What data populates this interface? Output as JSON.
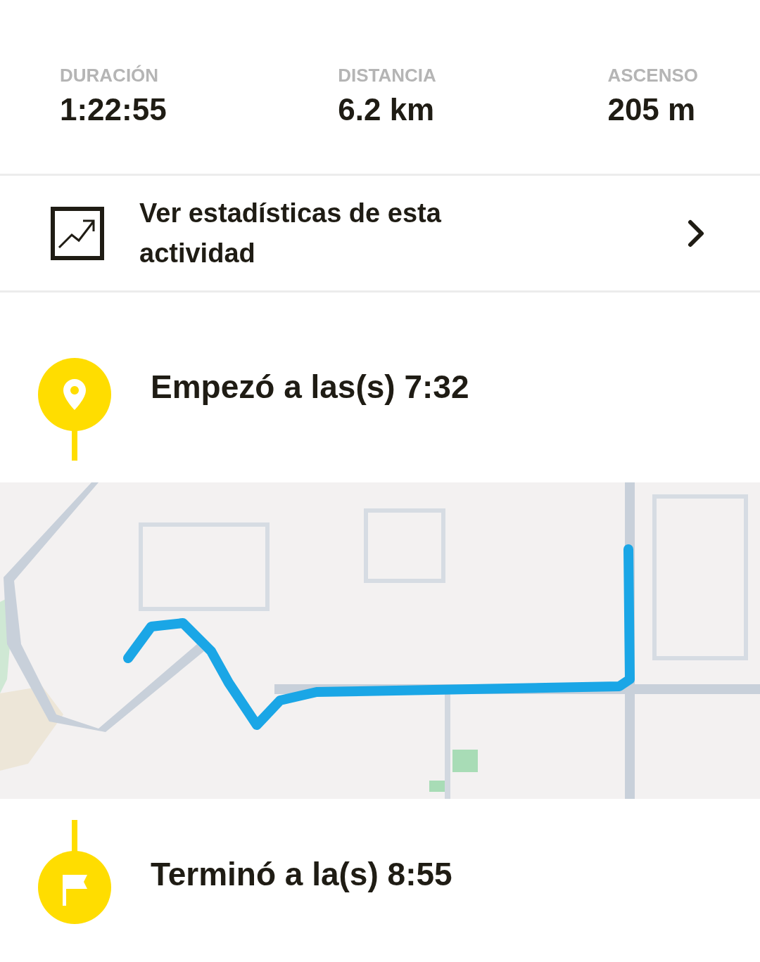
{
  "stats": [
    {
      "label": "DURACIÓN",
      "value": "1:22:55"
    },
    {
      "label": "DISTANCIA",
      "value": "6.2 km"
    },
    {
      "label": "ASCENSO",
      "value": "205 m"
    }
  ],
  "stats_link": {
    "label": "Ver estadísticas de esta actividad"
  },
  "start": {
    "kind": "start",
    "label": "Empezó a las(s) 7:32"
  },
  "end": {
    "kind": "end",
    "label": "Terminó a la(s) 8:55"
  }
}
